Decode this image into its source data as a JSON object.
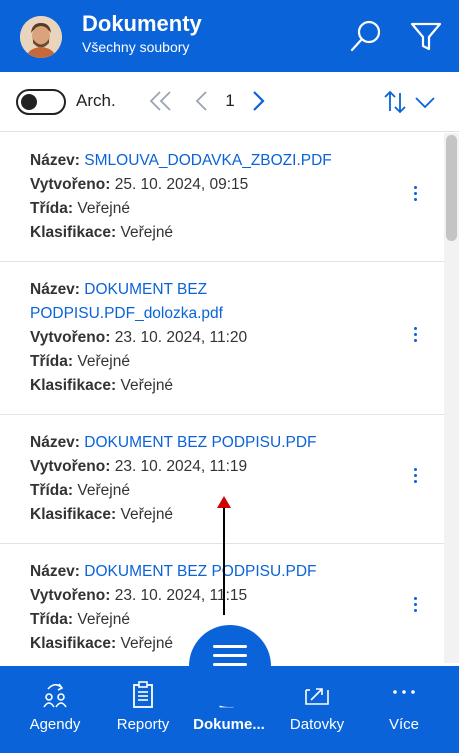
{
  "header": {
    "title": "Dokumenty",
    "subtitle": "Všechny soubory",
    "icons": [
      "avatar",
      "search-icon",
      "filter-icon"
    ]
  },
  "toolbar": {
    "archive_label": "Arch.",
    "archive_toggle_on": false,
    "page_number": "1",
    "icons": [
      "double-chevron-left-icon",
      "chevron-left-icon",
      "chevron-right-icon",
      "sort-icon",
      "chevron-down-icon"
    ]
  },
  "labels": {
    "name": "Název:",
    "created": "Vytvořeno:",
    "class": "Třída:",
    "classification": "Klasifikace:"
  },
  "documents": [
    {
      "name_line1": "SMLOUVA_DODAVKA_ZBOZI.PDF",
      "name_line2": "",
      "created": "25. 10. 2024, 09:15",
      "class": "Veřejné",
      "classification": "Veřejné"
    },
    {
      "name_line1": "DOKUMENT BEZ",
      "name_line2": "PODPISU.PDF_dolozka.pdf",
      "created": "23. 10. 2024, 11:20",
      "class": "Veřejné",
      "classification": "Veřejné"
    },
    {
      "name_line1": "DOKUMENT BEZ PODPISU.PDF",
      "name_line2": "",
      "created": "23. 10. 2024, 11:19",
      "class": "Veřejné",
      "classification": "Veřejné"
    },
    {
      "name_line1": "DOKUMENT BEZ PODPISU.PDF",
      "name_line2": "",
      "created": "23. 10. 2024, 11:15",
      "class": "Veřejné",
      "classification": "Veřejné"
    }
  ],
  "bottom_nav": [
    {
      "label": "Agendy",
      "icon": "agenda-icon",
      "active": false
    },
    {
      "label": "Reporty",
      "icon": "clipboard-icon",
      "active": false
    },
    {
      "label": "Dokume...",
      "icon": "documents-icon",
      "active": true
    },
    {
      "label": "Datovky",
      "icon": "databox-icon",
      "active": false
    },
    {
      "label": "Více",
      "icon": "more-icon",
      "active": false
    }
  ],
  "colors": {
    "primary": "#0a63d8",
    "link": "#0a63d8",
    "arrow": "#d00000"
  }
}
